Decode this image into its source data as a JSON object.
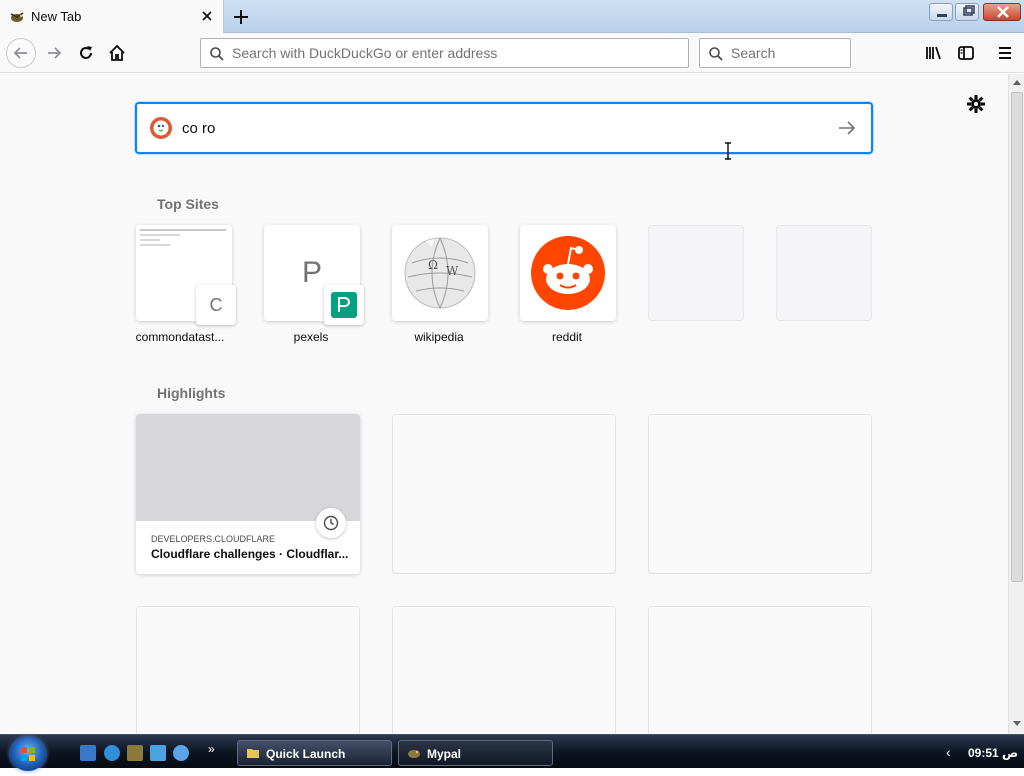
{
  "tab": {
    "title": "New Tab"
  },
  "toolbar": {
    "url_placeholder": "Search with DuckDuckGo or enter address",
    "search_placeholder": "Search"
  },
  "newtab": {
    "search_value": "co ro",
    "top_sites_title": "Top Sites",
    "top_sites": [
      {
        "label": "commondatast...",
        "letter": "C"
      },
      {
        "label": "pexels",
        "letter": "P"
      },
      {
        "label": "wikipedia"
      },
      {
        "label": "reddit"
      }
    ],
    "highlights_title": "Highlights",
    "highlights": [
      {
        "host": "DEVELOPERS.CLOUDFLARE",
        "title": "Cloudflare challenges · Cloudflar..."
      }
    ]
  },
  "taskbar": {
    "quick_launch": "Quick Launch",
    "app": "Mypal",
    "clock": "ص 09:51"
  },
  "colors": {
    "accent": "#0a84ff",
    "reddit": "#ff4500",
    "pexels": "#05a081",
    "ddg": "#de5833"
  }
}
